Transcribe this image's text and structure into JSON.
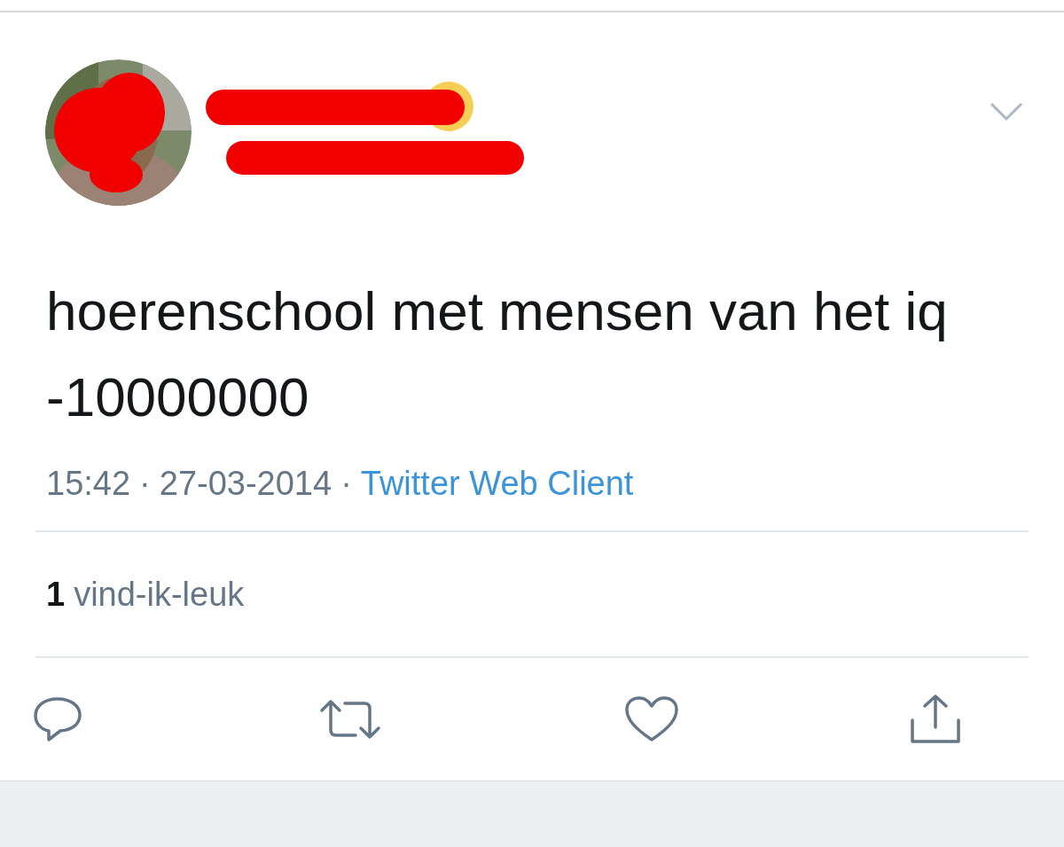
{
  "tweet": {
    "text": "hoerenschool met mensen van het iq -10000000"
  },
  "meta": {
    "time": "15:42",
    "separator_1": "·",
    "date": "27-03-2014",
    "separator_2": "·",
    "source": "Twitter Web Client"
  },
  "likes": {
    "count": "1",
    "label": "vind-ik-leuk"
  }
}
